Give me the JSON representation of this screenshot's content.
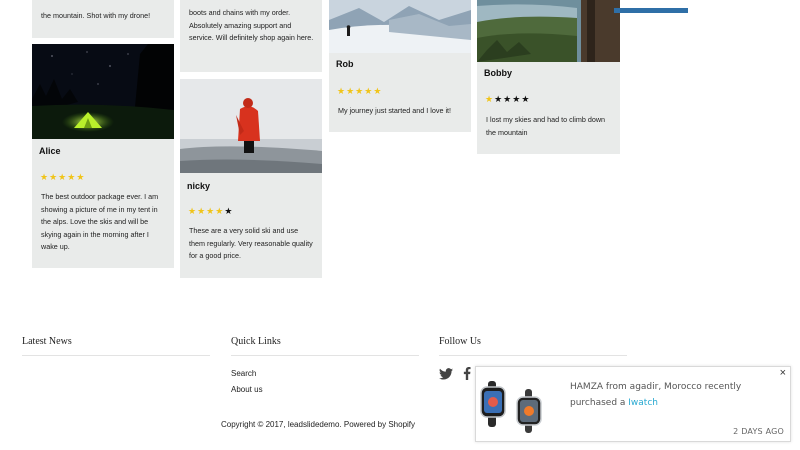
{
  "reviews": [
    {
      "name": "",
      "text": "the mountain. Shot with my drone!",
      "rating": 5
    },
    {
      "name": "Alice",
      "text": "The best outdoor package ever. I am showing a picture of me in my tent in the alps. Love the skis and will be skying again in the morning after I wake up.",
      "rating": 5
    },
    {
      "name": "",
      "text": "boots and chains with my order. Absolutely amazing support and service. Will definitely shop again here.",
      "rating": 5
    },
    {
      "name": "nicky",
      "text": "These are a very solid ski and use them regularly. Very reasonable quality for a good price.",
      "rating": 4
    },
    {
      "name": "Rob",
      "text": "My journey just started and I love it!",
      "rating": 5
    },
    {
      "name": "Bobby",
      "text": "I lost my skies and had to climb down the mountain",
      "rating": 1
    }
  ],
  "footer": {
    "latest_news": {
      "title": "Latest News"
    },
    "quick_links": {
      "title": "Quick Links",
      "links": [
        "Search",
        "About us"
      ]
    },
    "follow_us": {
      "title": "Follow Us",
      "icons": [
        "twitter-icon",
        "facebook-icon"
      ]
    },
    "copyright": {
      "prefix": "Copyright © 2017, ",
      "store_link": "leadslidedemo",
      "suffix": ". Powered by Shopify"
    }
  },
  "popup": {
    "message": "HAMZA from agadir, Morocco recently purchased a",
    "product": "Iwatch",
    "time": "2 DAYS AGO",
    "close_symbol": "×"
  },
  "colors": {
    "card_bg": "#e9ebea",
    "star_filled": "#f0c419",
    "star_empty": "#111111",
    "accent_blue": "#2f6fa7",
    "product_link": "#28a9d1"
  }
}
